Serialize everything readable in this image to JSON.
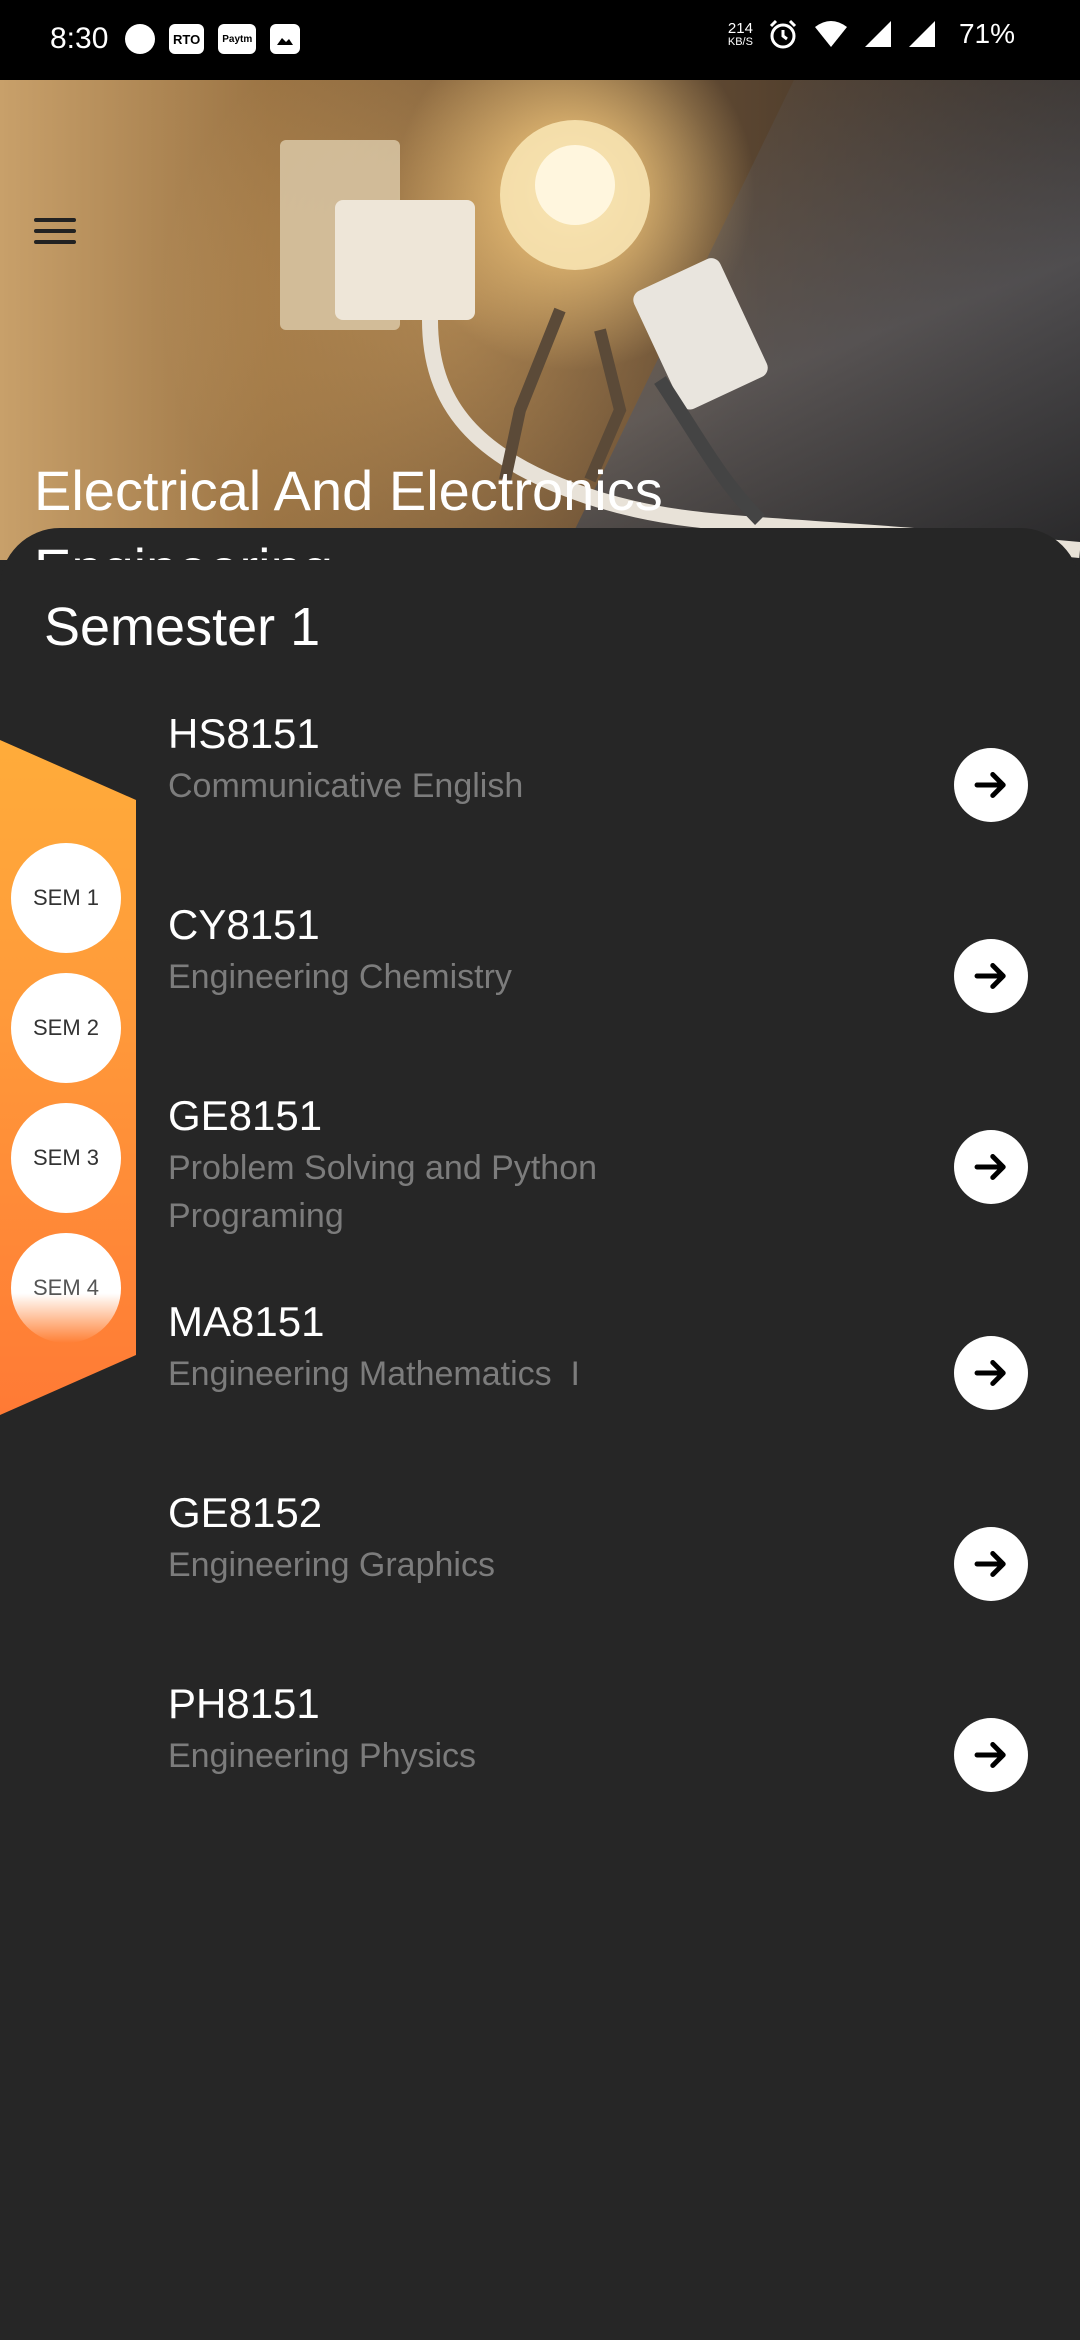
{
  "status_bar": {
    "time": "8:30",
    "left_badges": [
      "RTO",
      "Paytm"
    ],
    "speed_value": "214",
    "speed_unit": "KB/S",
    "battery": "71%"
  },
  "header": {
    "menu_icon": "hamburger-menu-icon",
    "title": "Electrical And Electronics Engineering"
  },
  "semester": {
    "title": "Semester 1",
    "courses": [
      {
        "code": "HS8151",
        "name": "Communicative English"
      },
      {
        "code": "CY8151",
        "name": "Engineering Chemistry"
      },
      {
        "code": "GE8151",
        "name": "Problem Solving and Python Programing"
      },
      {
        "code": "MA8151",
        "name": "Engineering Mathematics  I"
      },
      {
        "code": "GE8152",
        "name": "Engineering Graphics"
      },
      {
        "code": "PH8151",
        "name": "Engineering Physics"
      }
    ]
  },
  "semester_nav": {
    "items": [
      "SEM 1",
      "SEM 2",
      "SEM 3",
      "SEM 4"
    ],
    "accent_color": "#ff9a3a"
  },
  "colors": {
    "background": "#262626",
    "text_primary": "#ffffff",
    "text_secondary": "#7c7c7c",
    "button_bg": "#ffffff"
  }
}
